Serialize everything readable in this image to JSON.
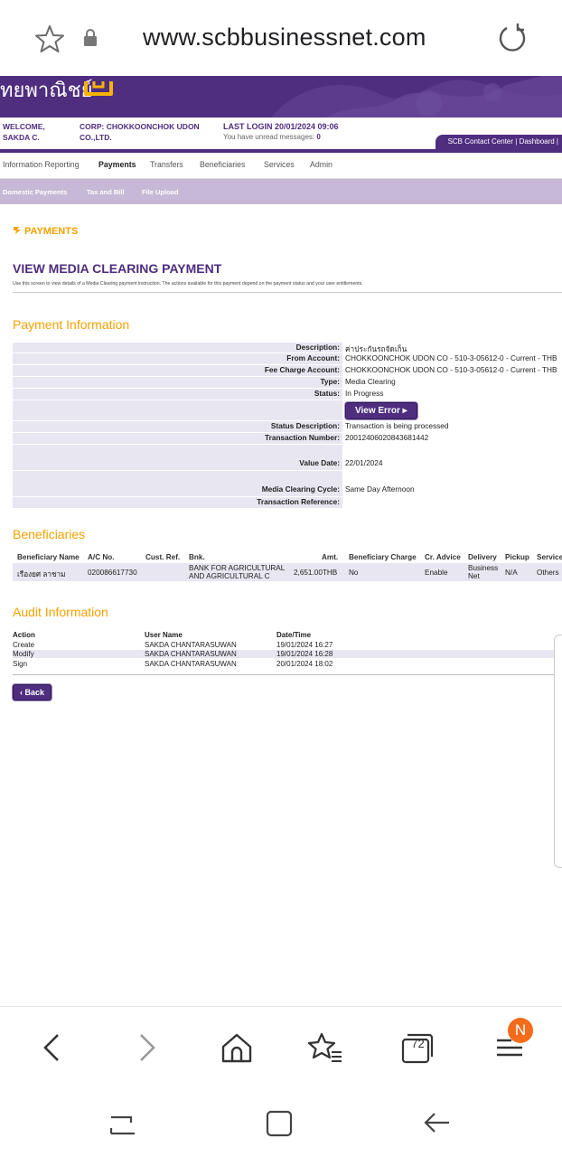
{
  "browser": {
    "url": "www.scbbusinessnet.com",
    "tab_count": "72",
    "badge": "N"
  },
  "banner": {
    "brand_text": "ทยพาณิชย์"
  },
  "info": {
    "welcome": "WELCOME,",
    "user": "SAKDA C.",
    "corp_line1": "CORP: CHOKKOONCHOK UDON",
    "corp_line2": "CO.,LTD.",
    "last_login": "LAST LOGIN  20/01/2024 09:06",
    "unread_prefix": "You have unread messages:",
    "unread_count": "0",
    "contact": "SCB Contact Center | Dashboard |"
  },
  "mainnav": [
    "Information Reporting",
    "Payments",
    "Transfers",
    "Beneficiaries",
    "Services",
    "Admin"
  ],
  "subnav": [
    "Domestic Payments",
    "Tax and Bill",
    "File Upload"
  ],
  "section_tag": "PAYMENTS",
  "page_title": "VIEW MEDIA CLEARING PAYMENT",
  "intro": "Use this screen to view details of a Media Clearing payment instruction. The actions available for this payment depend on the payment status and your user entitlements.",
  "payment": {
    "heading": "Payment Information",
    "rows": [
      {
        "label": "Description:",
        "value": "ค่าประกันรถจัดเก็น"
      },
      {
        "label": "From Account:",
        "value": "CHOKKOONCHOK UDON CO - 510-3-05612-0 - Current - THB"
      },
      {
        "label": "Fee Charge Account:",
        "value": "CHOKKOONCHOK UDON CO - 510-3-05612-0 - Current - THB"
      },
      {
        "label": "Type:",
        "value": "Media Clearing"
      },
      {
        "label": "Status:",
        "value": "In Progress"
      }
    ],
    "view_error": "View Error",
    "rows2": [
      {
        "label": "Status Description:",
        "value": "Transaction is being processed"
      },
      {
        "label": "Transaction Number:",
        "value": "20012406020843681442"
      }
    ],
    "value_date_label": "Value Date:",
    "value_date": "22/01/2024",
    "cycle_label": "Media Clearing Cycle:",
    "cycle": "Same Day Afternoon",
    "ref_label": "Transaction Reference:",
    "ref": ""
  },
  "beneficiaries": {
    "heading": "Beneficiaries",
    "columns": [
      "Beneficiary Name",
      "A/C No.",
      "Cust. Ref.",
      "Bnk.",
      "Amt.",
      "Beneficiary Charge",
      "Cr. Advice",
      "Delivery",
      "Pickup",
      "Service"
    ],
    "row": {
      "name": "เรืองยศ ลาชาม",
      "ac": "020086617730",
      "custref": "",
      "bank": "BANK FOR AGRICULTURAL AND AGRICULTURAL C",
      "amount": "2,651.00THB",
      "charge": "No",
      "advice": "Enable",
      "delivery": "Business Net",
      "pickup": "N/A",
      "service": "Others"
    }
  },
  "audit": {
    "heading": "Audit Information",
    "columns": [
      "Action",
      "User Name",
      "Date/Time"
    ],
    "rows": [
      {
        "action": "Create",
        "user": "SAKDA CHANTARASUWAN",
        "time": "19/01/2024 16:27"
      },
      {
        "action": "Modify",
        "user": "SAKDA CHANTARASUWAN",
        "time": "19/01/2024 16:28"
      },
      {
        "action": "Sign",
        "user": "SAKDA CHANTARASUWAN",
        "time": "20/01/2024 18:02"
      }
    ]
  },
  "back_label": "Back",
  "colors": {
    "brand_purple": "#4f2d7f",
    "accent_orange": "#f7a100",
    "row_fill": "#e8e6f0"
  }
}
